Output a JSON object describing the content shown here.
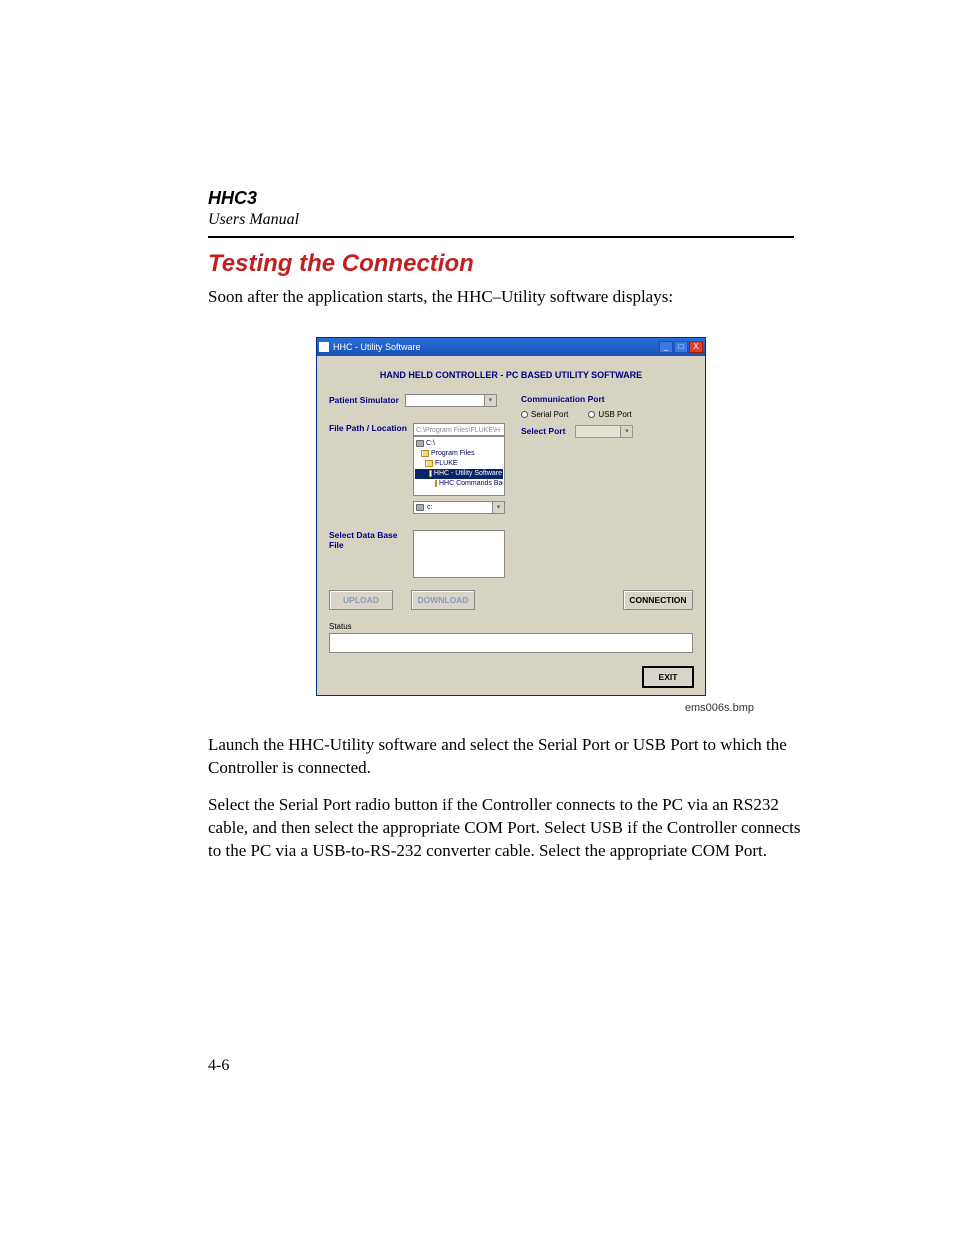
{
  "doc": {
    "product": "HHC3",
    "subtitle": "Users Manual",
    "section_title": "Testing the Connection",
    "intro": "Soon after the application starts, the HHC–Utility software displays:",
    "caption": "ems006s.bmp",
    "para2": "Launch the HHC-Utility software and select the Serial Port or USB Port to which the Controller is connected.",
    "para3": "Select the Serial Port radio button if the Controller connects to the PC via an RS232 cable, and then select the appropriate COM Port. Select USB if the Controller connects to the PC via a USB-to-RS-232 converter cable. Select the appropriate COM Port.",
    "page_num": "4-6"
  },
  "app": {
    "title": "HHC - Utility Software",
    "banner": "HAND HELD CONTROLLER - PC BASED UTILITY SOFTWARE",
    "labels": {
      "patient_simulator": "Patient Simulator",
      "file_path": "File Path / Location",
      "select_db": "Select Data Base File",
      "comm_port": "Communication Port",
      "serial": "Serial Port",
      "usb": "USB Port",
      "select_port": "Select Port",
      "status": "Status"
    },
    "path_value": "C:\\Program Files\\FLUKE\\H",
    "tree": {
      "n0": "C:\\",
      "n1": "Program Files",
      "n2": "FLUKE",
      "n3": "HHC - Utility Software",
      "n4": "HHC Commands Bac"
    },
    "drive": "c:",
    "buttons": {
      "upload": "UPLOAD",
      "download": "DOWNLOAD",
      "connection": "CONNECTION",
      "exit": "EXIT"
    }
  }
}
